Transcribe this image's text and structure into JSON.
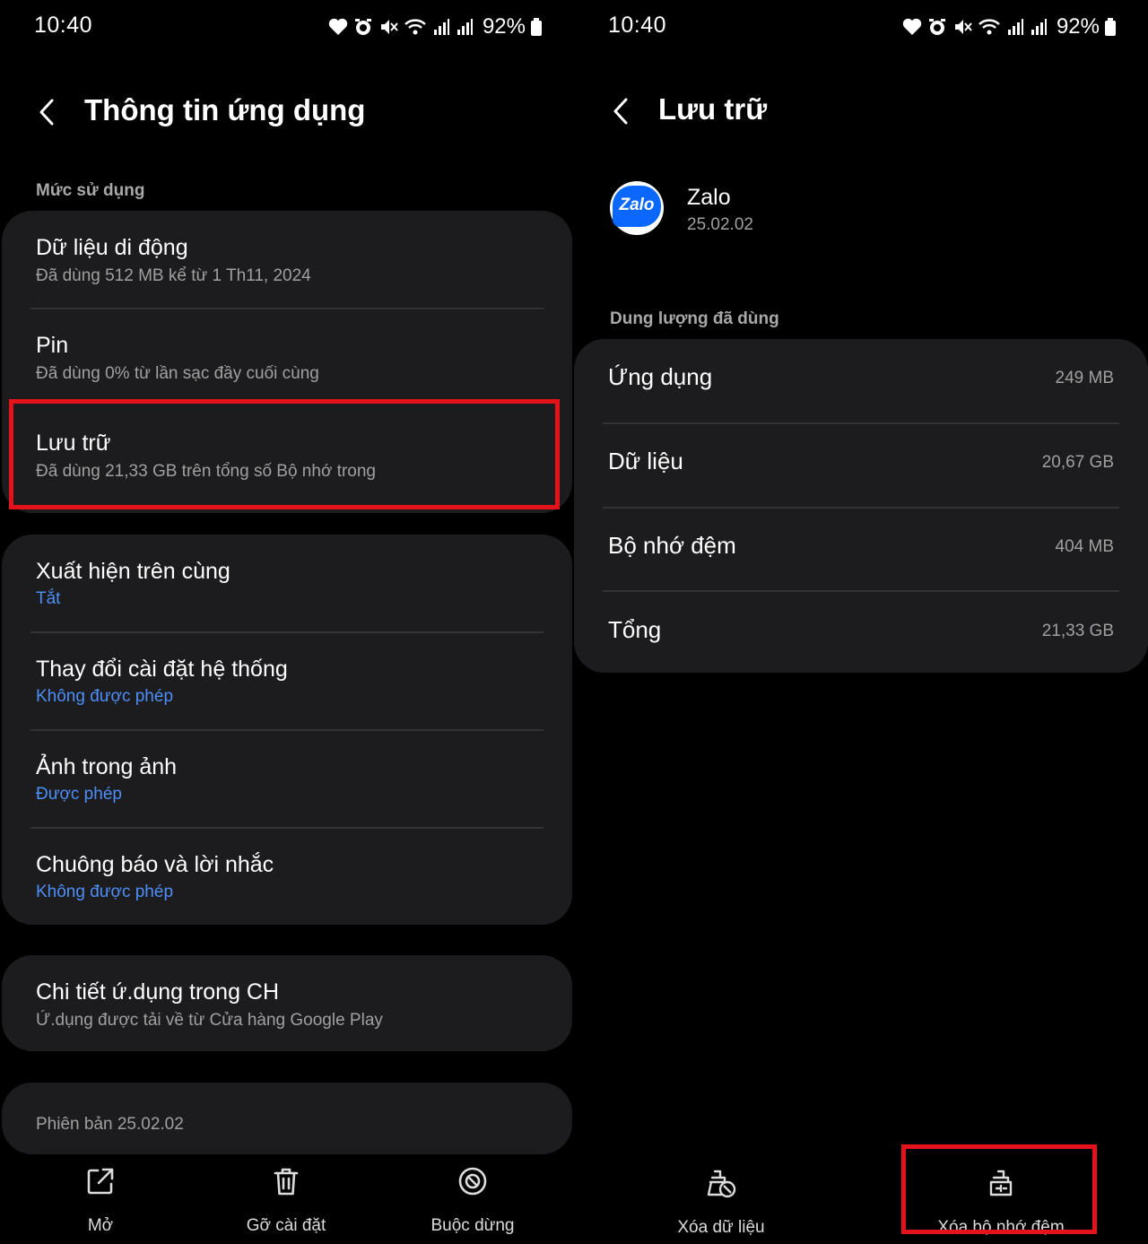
{
  "status_bar": {
    "time": "10:40",
    "battery": "92%"
  },
  "left": {
    "title": "Thông tin ứng dụng",
    "usage_label": "Mức sử dụng",
    "usage_items": [
      {
        "title": "Dữ liệu di động",
        "subtitle": "Đã dùng 512 MB kể từ 1 Th11, 2024"
      },
      {
        "title": "Pin",
        "subtitle": "Đã dùng 0% từ lần sạc đầy cuối cùng"
      },
      {
        "title": "Lưu trữ",
        "subtitle": "Đã dùng 21,33 GB trên tổng số Bộ nhớ trong"
      }
    ],
    "permission_items": [
      {
        "title": "Xuất hiện trên cùng",
        "subtitle": "Tắt"
      },
      {
        "title": "Thay đổi cài đặt hệ thống",
        "subtitle": "Không được phép"
      },
      {
        "title": "Ảnh trong ảnh",
        "subtitle": "Được phép"
      },
      {
        "title": "Chuông báo và lời nhắc",
        "subtitle": "Không được phép"
      }
    ],
    "store_item": {
      "title": "Chi tiết ứ.dụng trong CH",
      "subtitle": "Ứ.dụng được tải về từ Cửa hàng Google Play"
    },
    "version": "Phiên bản 25.02.02",
    "bottom_actions": [
      {
        "label": "Mở",
        "icon": "open-icon"
      },
      {
        "label": "Gỡ cài đặt",
        "icon": "trash-icon"
      },
      {
        "label": "Buộc dừng",
        "icon": "stop-icon"
      }
    ]
  },
  "right": {
    "title": "Lưu trữ",
    "app": {
      "name": "Zalo",
      "version": "25.02.02",
      "logo_text": "Zalo"
    },
    "used_label": "Dung lượng đã dùng",
    "storage_rows": [
      {
        "label": "Ứng dụng",
        "value": "249 MB"
      },
      {
        "label": "Dữ liệu",
        "value": "20,67 GB"
      },
      {
        "label": "Bộ nhớ đệm",
        "value": "404 MB"
      },
      {
        "label": "Tổng",
        "value": "21,33 GB"
      }
    ],
    "bottom_actions": [
      {
        "label": "Xóa dữ liệu",
        "icon": "clear-data-icon"
      },
      {
        "label": "Xóa bộ nhớ đệm",
        "icon": "clear-cache-icon"
      }
    ]
  },
  "colors": {
    "background": "#000000",
    "card": "#1c1c1e",
    "accent_blue": "#4d8ef7",
    "highlight_red": "#e3121b"
  }
}
